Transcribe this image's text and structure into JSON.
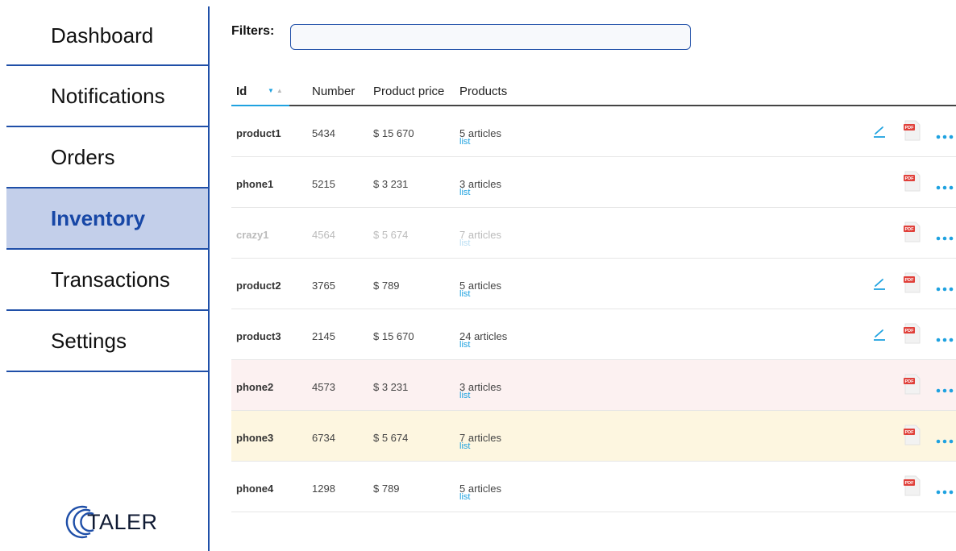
{
  "sidebar": {
    "items": [
      {
        "label": "Dashboard"
      },
      {
        "label": "Notifications"
      },
      {
        "label": "Orders"
      },
      {
        "label": "Inventory"
      },
      {
        "label": "Transactions"
      },
      {
        "label": "Settings"
      }
    ],
    "active": "Inventory",
    "logo_text": "TALER"
  },
  "filters": {
    "label": "Filters:",
    "value": "",
    "placeholder": ""
  },
  "table": {
    "columns": [
      "Id",
      "Number",
      "Product price",
      "Products"
    ],
    "sort": {
      "column": "Id",
      "direction": "descending"
    },
    "rows": [
      {
        "id": "product1",
        "number": "5434",
        "price": "$ 15 670",
        "products": "5 articles",
        "link": "list",
        "state": "normal",
        "editable": true
      },
      {
        "id": "phone1",
        "number": "5215",
        "price": "$ 3 231",
        "products": "3 articles",
        "link": "list",
        "state": "normal",
        "editable": false
      },
      {
        "id": "crazy1",
        "number": "4564",
        "price": "$ 5 674",
        "products": "7 articles",
        "link": "list",
        "state": "disabled",
        "editable": false
      },
      {
        "id": "product2",
        "number": "3765",
        "price": "$ 789",
        "products": "5 articles",
        "link": "list",
        "state": "normal",
        "editable": true
      },
      {
        "id": "product3",
        "number": "2145",
        "price": "$ 15 670",
        "products": "24 articles",
        "link": "list",
        "state": "normal",
        "editable": true
      },
      {
        "id": "phone2",
        "number": "4573",
        "price": "$ 3 231",
        "products": "3 articles",
        "link": "list",
        "state": "error",
        "editable": false
      },
      {
        "id": "phone3",
        "number": "6734",
        "price": "$ 5 674",
        "products": "7 articles",
        "link": "list",
        "state": "warning",
        "editable": false
      },
      {
        "id": "phone4",
        "number": "1298",
        "price": "$ 789",
        "products": "5 articles",
        "link": "list",
        "state": "normal",
        "editable": false
      }
    ],
    "row_actions": {
      "edit_icon": "pencil-icon",
      "pdf_icon": "pdf-icon",
      "pdf_badge": "PDF",
      "more_icon": "more-options-icon"
    }
  },
  "colors": {
    "accent": "#1fa2e0",
    "nav_border": "#1f4fa8",
    "nav_active_bg": "#c3cfea",
    "nav_active_text": "#1747a6",
    "row_error_bg": "#fcf1f1",
    "row_warning_bg": "#fdf6e0",
    "pdf_red": "#e0403a"
  }
}
